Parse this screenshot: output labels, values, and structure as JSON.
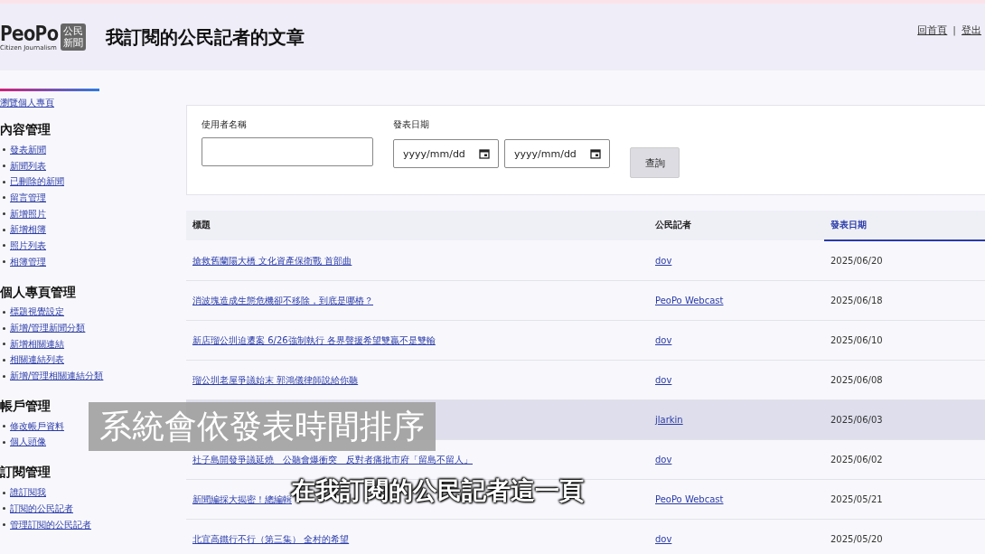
{
  "header": {
    "logo": {
      "word": "PeoPo",
      "badge": "公民新聞",
      "tagline": "Citizen Journalism"
    },
    "title": "我訂閱的公民記者的文章",
    "links": [
      "回首頁",
      "登出"
    ],
    "separator": "|"
  },
  "sidebar": {
    "top_link": "瀏覽個人專頁",
    "sections": [
      {
        "heading": "內容管理",
        "items": [
          "發表新聞",
          "新聞列表",
          "已刪除的新聞",
          "留言管理",
          "新增照片",
          "新增相簿",
          "照片列表",
          "相簿管理"
        ]
      },
      {
        "heading": "個人專頁管理",
        "items": [
          "標題視覺設定",
          "新增/管理新聞分類",
          "新增相關連結",
          "相關連結列表",
          "新增/管理相關連結分類"
        ]
      },
      {
        "heading": "帳戶管理",
        "items": [
          "修改帳戶資料",
          "個人頭像"
        ]
      },
      {
        "heading": "訂閱管理",
        "items": [
          "誰訂閱我",
          "訂閱的公民記者",
          "管理訂閱的公民記者"
        ]
      }
    ]
  },
  "search": {
    "user_label": "使用者名稱",
    "date_label": "發表日期",
    "date_placeholders": [
      "yyyy/mm/dd",
      "yyyy/mm/dd"
    ],
    "button": "查詢"
  },
  "table": {
    "columns": [
      {
        "label": "標題",
        "sorted": false
      },
      {
        "label": "公民記者",
        "sorted": false
      },
      {
        "label": "發表日期",
        "sorted": true
      }
    ],
    "rows": [
      {
        "title": "搶救舊蘭陽大橋 文化資產保衛戰 首部曲",
        "author": "dov",
        "date": "2025/06/20",
        "hovered": false
      },
      {
        "title": "消波塊造成生態危機卻不移除，到底是哪樁？",
        "author": "PeoPo Webcast",
        "date": "2025/06/18",
        "hovered": false
      },
      {
        "title": "新店瑠公圳迫遷案 6/26強制執行 各界聲援希望雙贏不是雙輸",
        "author": "dov",
        "date": "2025/06/10",
        "hovered": false
      },
      {
        "title": "瑠公圳老屋爭議始末 郭鴻儀律師說給你聽",
        "author": "dov",
        "date": "2025/06/08",
        "hovered": false
      },
      {
        "author": "jlarkin",
        "date": "2025/06/03",
        "hovered": true
      },
      {
        "title": "社子島開發爭議延燒　公聽會爆衝突　反對者痛批市府「留島不留人」",
        "author": "dov",
        "date": "2025/06/02",
        "hovered": false
      },
      {
        "title": "新聞編採大揭密！總編輯",
        "author": "PeoPo Webcast",
        "date": "2025/05/21",
        "hovered": false
      },
      {
        "title": "北宜高鐵行不行（第三集） 全村的希望",
        "author": "dov",
        "date": "2025/05/20",
        "hovered": false
      }
    ]
  },
  "subtitles": [
    {
      "text": "系統會依發表時間排序",
      "kind": "boxed"
    },
    {
      "text": "在我訂閱的公民記者這一頁",
      "kind": "outlined"
    }
  ]
}
